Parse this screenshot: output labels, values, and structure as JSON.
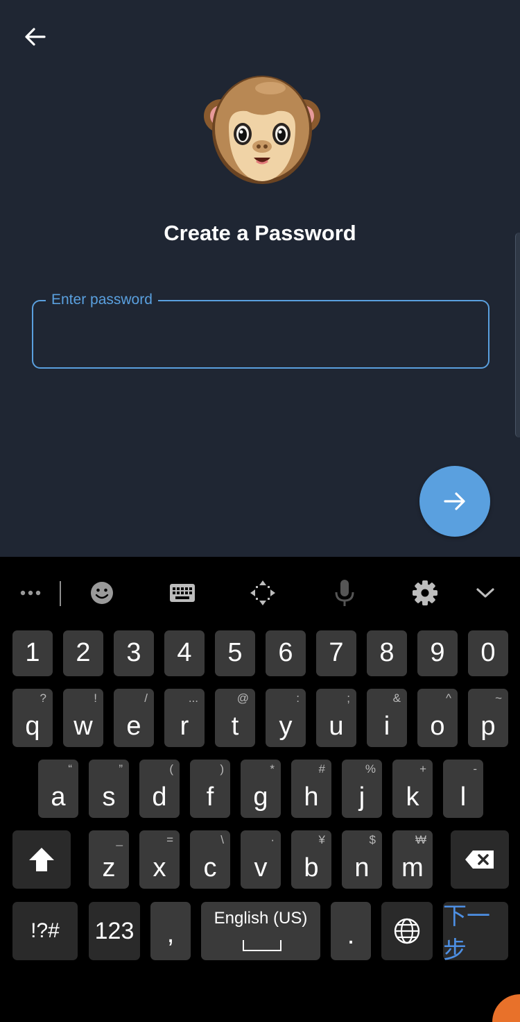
{
  "screen": {
    "title": "Create a Password",
    "password_label": "Enter password",
    "password_value": ""
  },
  "icons": {
    "back": "arrow-left-icon",
    "mascot": "monkey-face-icon",
    "next": "arrow-right-icon"
  },
  "colors": {
    "background": "#1f2633",
    "accent": "#5aa0df",
    "keyboard_bg": "#000000",
    "key_bg": "#3a3a3a",
    "next_key_text": "#4d8fe3"
  },
  "keyboard": {
    "toolbar": [
      "more-icon",
      "emoji-icon",
      "keyboard-icon",
      "move-icon",
      "microphone-icon",
      "settings-icon",
      "chevron-down-icon"
    ],
    "number_row": [
      "1",
      "2",
      "3",
      "4",
      "5",
      "6",
      "7",
      "8",
      "9",
      "0"
    ],
    "row1": [
      {
        "main": "q",
        "sec": "?"
      },
      {
        "main": "w",
        "sec": "!"
      },
      {
        "main": "e",
        "sec": "/"
      },
      {
        "main": "r",
        "sec": "..."
      },
      {
        "main": "t",
        "sec": "@"
      },
      {
        "main": "y",
        "sec": ":"
      },
      {
        "main": "u",
        "sec": ";"
      },
      {
        "main": "i",
        "sec": "&"
      },
      {
        "main": "o",
        "sec": "^"
      },
      {
        "main": "p",
        "sec": "~"
      }
    ],
    "row2": [
      {
        "main": "a",
        "sec": "“"
      },
      {
        "main": "s",
        "sec": "”"
      },
      {
        "main": "d",
        "sec": "("
      },
      {
        "main": "f",
        "sec": ")"
      },
      {
        "main": "g",
        "sec": "*"
      },
      {
        "main": "h",
        "sec": "#"
      },
      {
        "main": "j",
        "sec": "%"
      },
      {
        "main": "k",
        "sec": "+"
      },
      {
        "main": "l",
        "sec": "-"
      }
    ],
    "row3": [
      {
        "main": "z",
        "sec": "_"
      },
      {
        "main": "x",
        "sec": "="
      },
      {
        "main": "c",
        "sec": "\\"
      },
      {
        "main": "v",
        "sec": "·"
      },
      {
        "main": "b",
        "sec": "¥"
      },
      {
        "main": "n",
        "sec": "$"
      },
      {
        "main": "m",
        "sec": "₩"
      }
    ],
    "symbols_label": "!?#",
    "numbers_label": "123",
    "comma_label": ",",
    "space_label": "English (US)",
    "period_label": ".",
    "next_label": "下一步"
  }
}
